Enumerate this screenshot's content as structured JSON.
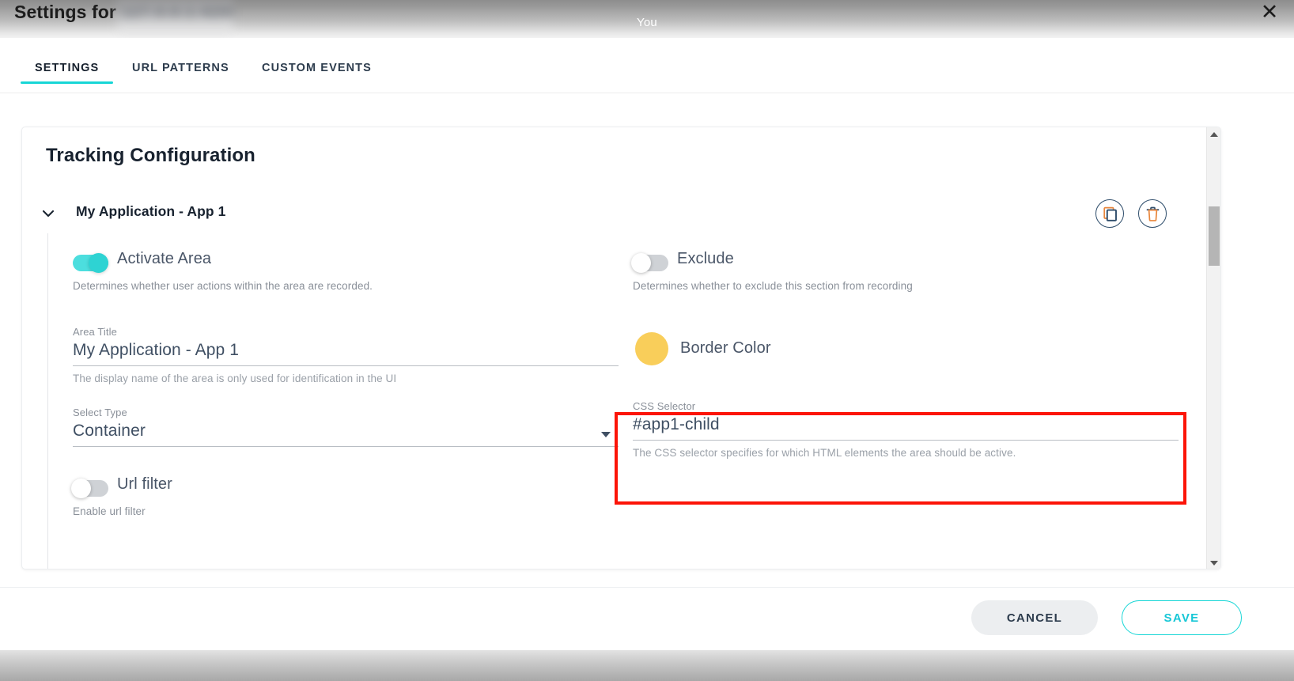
{
  "titlebar": {
    "title_prefix": "Settings for",
    "redacted_host": "127.0.0.1:4200",
    "center_label": "You",
    "close_icon": "close-icon"
  },
  "tabs": [
    {
      "label": "SETTINGS",
      "active": true
    },
    {
      "label": "URL PATTERNS",
      "active": false
    },
    {
      "label": "CUSTOM EVENTS",
      "active": false
    }
  ],
  "card": {
    "title": "Tracking Configuration",
    "accordion": {
      "label": "My Application - App 1",
      "chevron_icon": "chevron-down-icon",
      "actions": [
        {
          "icon": "copy-icon",
          "name": "duplicate-area-button"
        },
        {
          "icon": "trash-icon",
          "name": "delete-area-button"
        }
      ]
    },
    "fields": {
      "activate_area": {
        "label": "Activate Area",
        "hint": "Determines whether user actions within the area are recorded.",
        "state": "on"
      },
      "exclude": {
        "label": "Exclude",
        "hint": "Determines whether to exclude this section from recording",
        "state": "off"
      },
      "area_title": {
        "label": "Area Title",
        "value": "My Application - App 1",
        "hint": "The display name of the area is only used for identification in the UI"
      },
      "border_color": {
        "label": "Border Color",
        "color": "#F9CE5A"
      },
      "select_type": {
        "label": "Select Type",
        "value": "Container",
        "caret_icon": "chevron-down-icon"
      },
      "css_selector": {
        "label": "CSS Selector",
        "value": "#app1-child",
        "hint": "The CSS selector specifies for which HTML elements the area should be active.",
        "highlight_color": "#FC1408"
      },
      "url_filter": {
        "label": "Url filter",
        "hint": "Enable url filter",
        "state": "off"
      }
    }
  },
  "scrollbar": {
    "up_icon": "chevron-up-icon",
    "down_icon": "chevron-down-icon"
  },
  "footer": {
    "cancel_label": "CANCEL",
    "save_label": "SAVE"
  },
  "colors": {
    "accent": "#17D6D6",
    "toggle_on": "#4CDEDE",
    "icon_dark": "#2E4D6B",
    "icon_orange": "#E8863C",
    "highlight": "#FC1408"
  }
}
